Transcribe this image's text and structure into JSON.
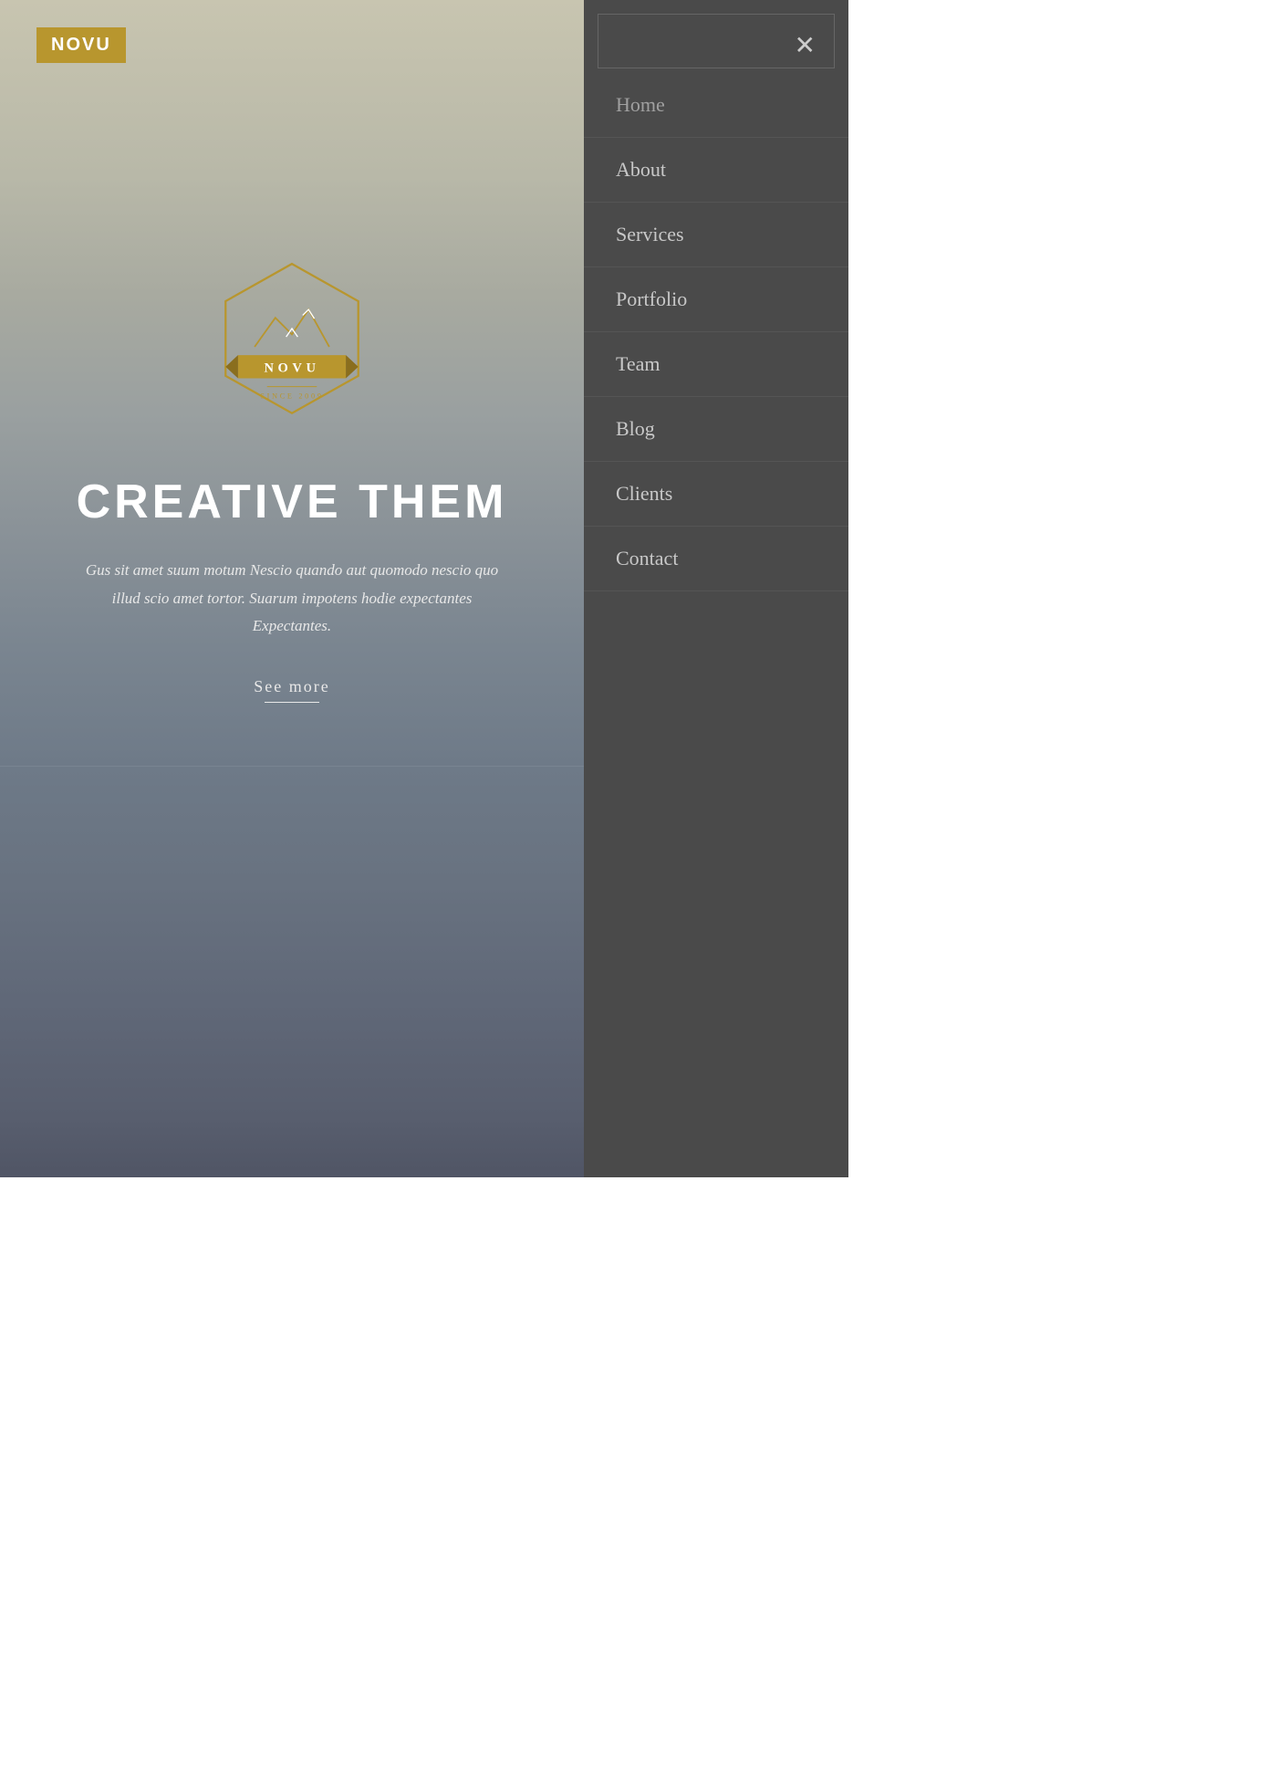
{
  "site": {
    "logo": "NOVU",
    "badge_name": "NOVU",
    "badge_since": "SINCE 2009"
  },
  "hero": {
    "title": "CREATIVE THEM",
    "subtitle": "Gus sit amet suum motum Nescio quando aut quomodo nescio quo illud scio amet tortor. Suarum impotens hodie expectantes Expectantes.",
    "cta_label": "See more"
  },
  "nav": {
    "close_icon": "✕",
    "items": [
      {
        "label": "Home",
        "id": "home"
      },
      {
        "label": "About",
        "id": "about"
      },
      {
        "label": "Services",
        "id": "services"
      },
      {
        "label": "Portfolio",
        "id": "portfolio"
      },
      {
        "label": "Team",
        "id": "team"
      },
      {
        "label": "Blog",
        "id": "blog"
      },
      {
        "label": "Clients",
        "id": "clients"
      },
      {
        "label": "Contact",
        "id": "contact"
      }
    ]
  },
  "colors": {
    "gold": "#b8962e",
    "sidebar_bg": "#4a4a4a",
    "nav_text": "#c8c8c8",
    "white": "#ffffff"
  }
}
